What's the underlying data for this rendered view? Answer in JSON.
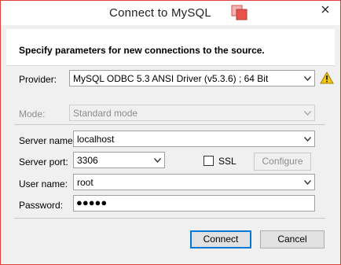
{
  "window": {
    "title": "Connect to MySQL",
    "icons": [
      "mysql-icon",
      "close-icon"
    ]
  },
  "header": {
    "text": "Specify parameters for new connections to the source."
  },
  "form": {
    "provider": {
      "label": "Provider:",
      "value": "MySQL ODBC 5.3 ANSI Driver (v5.3.6) ; 64 Bit",
      "warning_icon": "warning-icon"
    },
    "mode": {
      "label": "Mode:",
      "value": "Standard mode",
      "disabled": true
    },
    "server_name": {
      "label": "Server name:",
      "value": "localhost"
    },
    "server_port": {
      "label": "Server port:",
      "value": "3306"
    },
    "ssl": {
      "label": "SSL",
      "checked": false
    },
    "configure": {
      "label": "Configure",
      "disabled": true
    },
    "user_name": {
      "label": "User name:",
      "value": "root"
    },
    "password": {
      "label": "Password:",
      "masked_value": "●●●●●"
    }
  },
  "footer": {
    "connect_label": "Connect",
    "cancel_label": "Cancel"
  },
  "colors": {
    "window_border": "#e0403a",
    "accent": "#0078d7",
    "warning": "#f2c811",
    "dialog_bg": "#f0f0f0"
  }
}
